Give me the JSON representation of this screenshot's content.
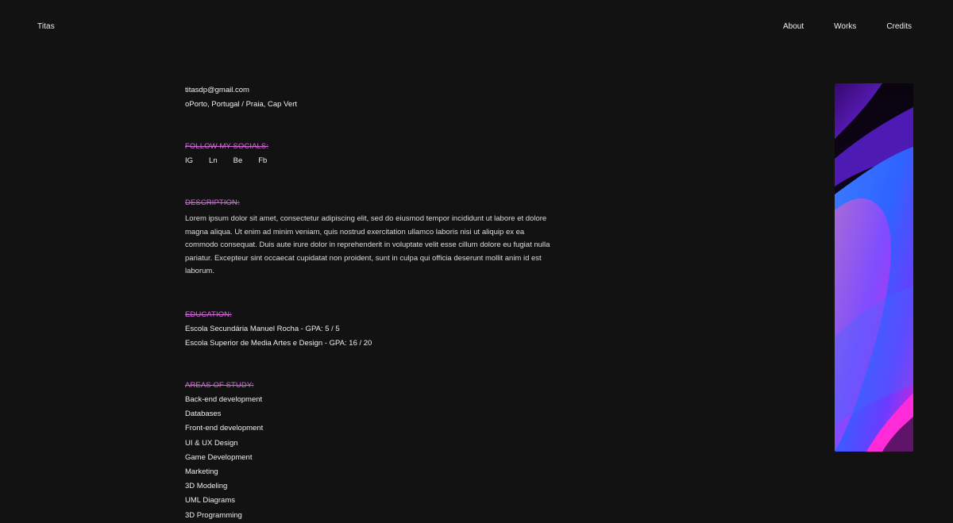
{
  "header": {
    "brand": "Titas",
    "nav": [
      "About",
      "Works",
      "Credits"
    ]
  },
  "contact": {
    "email": "titasdp@gmail.com",
    "location": "oPorto, Portugal / Praia, Cap Vert"
  },
  "socials": {
    "title": "FOLLOW MY SOCIALS:",
    "links": [
      "IG",
      "Ln",
      "Be",
      "Fb"
    ]
  },
  "description": {
    "title": "DESCRIPTION:",
    "text": "Lorem ipsum dolor sit amet, consectetur adipiscing elit, sed do eiusmod tempor incididunt ut labore et dolore magna aliqua. Ut enim ad minim veniam, quis nostrud exercitation ullamco laboris nisi ut aliquip ex ea commodo consequat. Duis aute irure dolor in reprehenderit in voluptate velit esse cillum dolore eu fugiat nulla pariatur. Excepteur sint occaecat cupidatat non proident, sunt in culpa qui officia deserunt mollit anim id est laborum."
  },
  "education": {
    "title": "EDUCATION:",
    "items": [
      "Escola Secundária Manuel Rocha - GPA: 5 / 5",
      "Escola Superior de Media Artes e Design - GPA: 16 / 20"
    ]
  },
  "areas": {
    "title": "AREAS OF STUDY:",
    "items": [
      "Back-end development",
      "Databases",
      "Front-end development",
      "UI & UX Design",
      "Game Development",
      "Marketing",
      "3D Modeling",
      "UML Diagrams",
      "3D Programming"
    ]
  },
  "colors": {
    "background": "#121212",
    "accent": "#d06bd8",
    "text": "#ededed"
  }
}
